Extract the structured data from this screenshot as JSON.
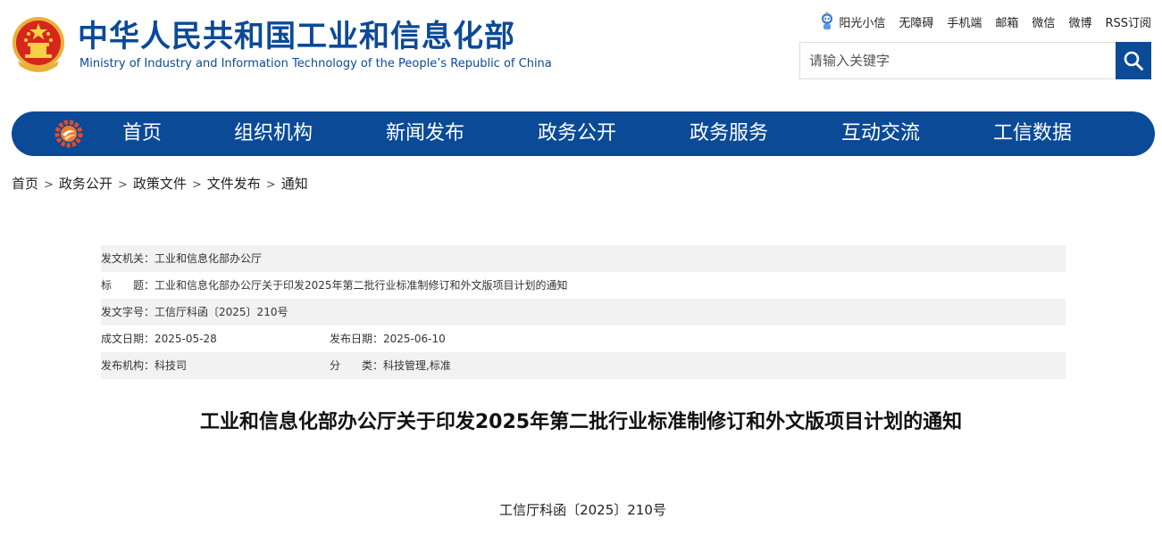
{
  "header": {
    "title_cn": "中华人民共和国工业和信息化部",
    "title_en": "Ministry of Industry and Information Technology of the People’s Republic of China",
    "brand_color": "#0b4a97",
    "top_links": [
      {
        "label": "阳光小信",
        "icon": "robot-icon"
      },
      {
        "label": "无障碍"
      },
      {
        "label": "手机端"
      },
      {
        "label": "邮箱"
      },
      {
        "label": "微信"
      },
      {
        "label": "微博"
      },
      {
        "label": "RSS订阅"
      }
    ],
    "search": {
      "placeholder": "请输入关键字",
      "icon": "search-icon"
    }
  },
  "nav": {
    "items": [
      "首页",
      "组织机构",
      "新闻发布",
      "政务公开",
      "政务服务",
      "互动交流",
      "工信数据"
    ]
  },
  "breadcrumb": [
    "首页",
    "政务公开",
    "政策文件",
    "文件发布",
    "通知"
  ],
  "meta": {
    "issuer_label": "发文机关：",
    "issuer": "工业和信息化部办公厅",
    "title_label": "标　　题：",
    "title": "工业和信息化部办公厅关于印发2025年第二批行业标准制修订和外文版项目计划的通知",
    "doc_no_label": "发文字号：",
    "doc_no": "工信厅科函〔2025〕210号",
    "created_label": "成文日期：",
    "created": "2025-05-28",
    "published_label": "发布日期：",
    "published": "2025-06-10",
    "agency_label": "发布机构：",
    "agency": "科技司",
    "category_label": "分　　类：",
    "category": "科技管理,标准"
  },
  "article": {
    "title": "工业和信息化部办公厅关于印发2025年第二批行业标准制修订和外文版项目计划的通知",
    "doc_number": "工信厅科函〔2025〕210号"
  }
}
